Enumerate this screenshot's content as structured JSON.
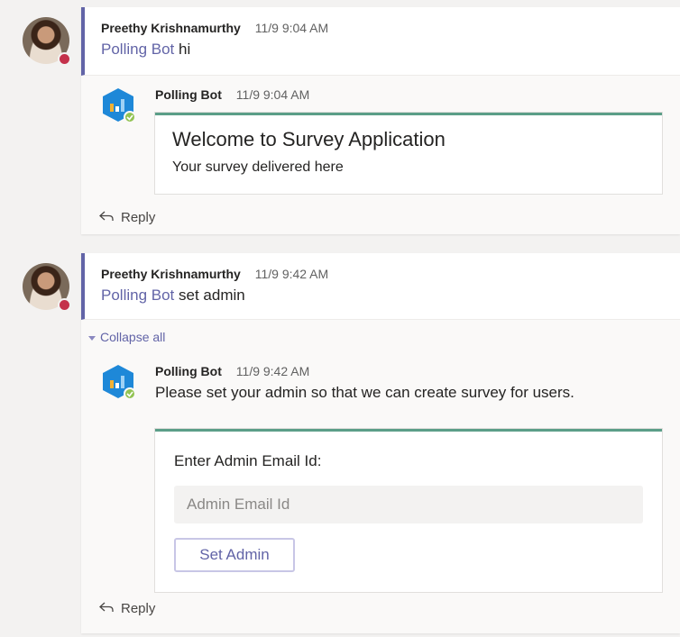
{
  "colors": {
    "accent": "#6264a7",
    "card_border": "#5b9e88",
    "presence_busy": "#c4314b",
    "bot_online": "#92c353"
  },
  "icons": {
    "reply": "reply-arrow-icon",
    "bot": "polling-bot-chart-icon",
    "collapse": "caret-down-icon"
  },
  "thread1": {
    "root": {
      "sender": "Preethy Krishnamurthy",
      "timestamp": "11/9 9:04 AM",
      "mention": "Polling Bot",
      "text": " hi"
    },
    "bot_reply": {
      "sender": "Polling Bot",
      "timestamp": "11/9 9:04 AM",
      "card_title": "Welcome to Survey Application",
      "card_subtitle": "Your survey delivered here"
    },
    "reply_label": "Reply"
  },
  "thread2": {
    "root": {
      "sender": "Preethy Krishnamurthy",
      "timestamp": "11/9 9:42 AM",
      "mention": "Polling Bot",
      "text": " set admin"
    },
    "collapse_label": "Collapse all",
    "bot_reply": {
      "sender": "Polling Bot",
      "timestamp": "11/9 9:42 AM",
      "text": "Please set your admin so that we can create survey for users.",
      "field_label": "Enter Admin Email Id:",
      "input_placeholder": "Admin Email Id",
      "input_value": "",
      "button_label": "Set Admin"
    },
    "reply_label": "Reply"
  }
}
